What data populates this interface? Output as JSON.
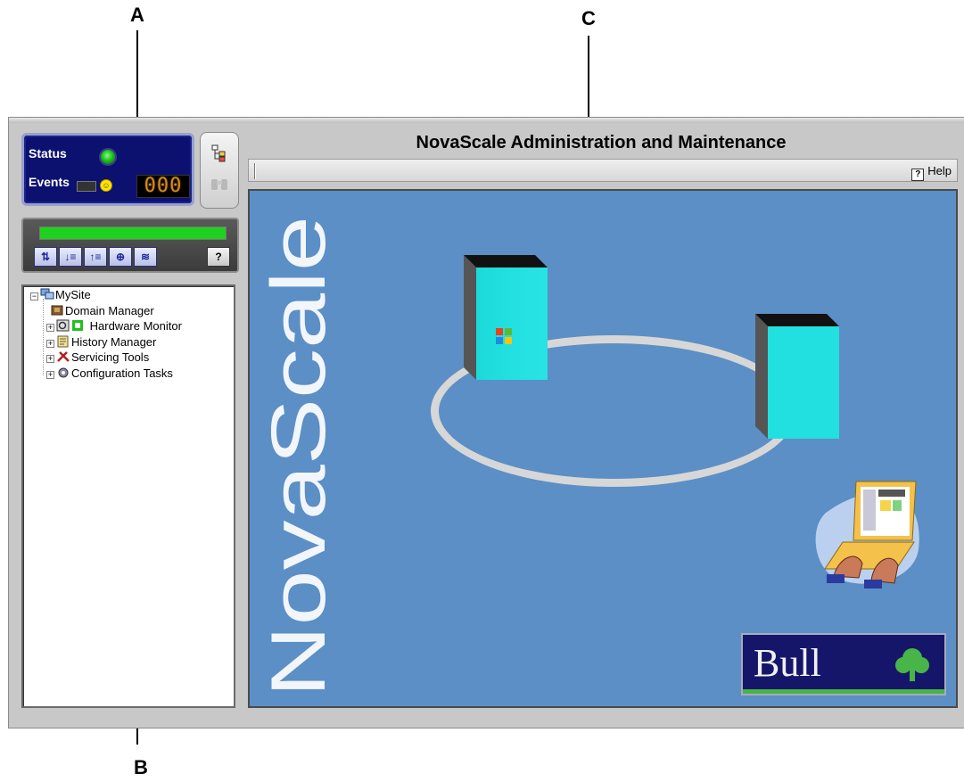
{
  "callouts": {
    "a": "A",
    "b": "B",
    "c": "C"
  },
  "status_panel": {
    "status_label": "Status",
    "events_label": "Events",
    "events_count": "000"
  },
  "toolbar": {
    "progress_percent": 100,
    "buttons": [
      "refresh",
      "sort",
      "tree-top",
      "network",
      "list",
      "help"
    ]
  },
  "tree": {
    "root": "MySite",
    "items": [
      {
        "label": "Domain Manager",
        "icon": "domain-manager-icon"
      },
      {
        "label": "Hardware Monitor",
        "icon": "hardware-monitor-icon"
      },
      {
        "label": "History Manager",
        "icon": "history-manager-icon"
      },
      {
        "label": "Servicing Tools",
        "icon": "servicing-tools-icon"
      },
      {
        "label": "Configuration Tasks",
        "icon": "configuration-tasks-icon"
      }
    ]
  },
  "main": {
    "title": "NovaScale Administration and Maintenance",
    "help_label": "Help",
    "brand_text": "NovaScale",
    "logo_text": "Bull"
  },
  "colors": {
    "canvas_bg": "#5b8fc6",
    "status_bg": "#0c1170",
    "progress": "#1fd11f",
    "server_face": "#22e0e0"
  }
}
